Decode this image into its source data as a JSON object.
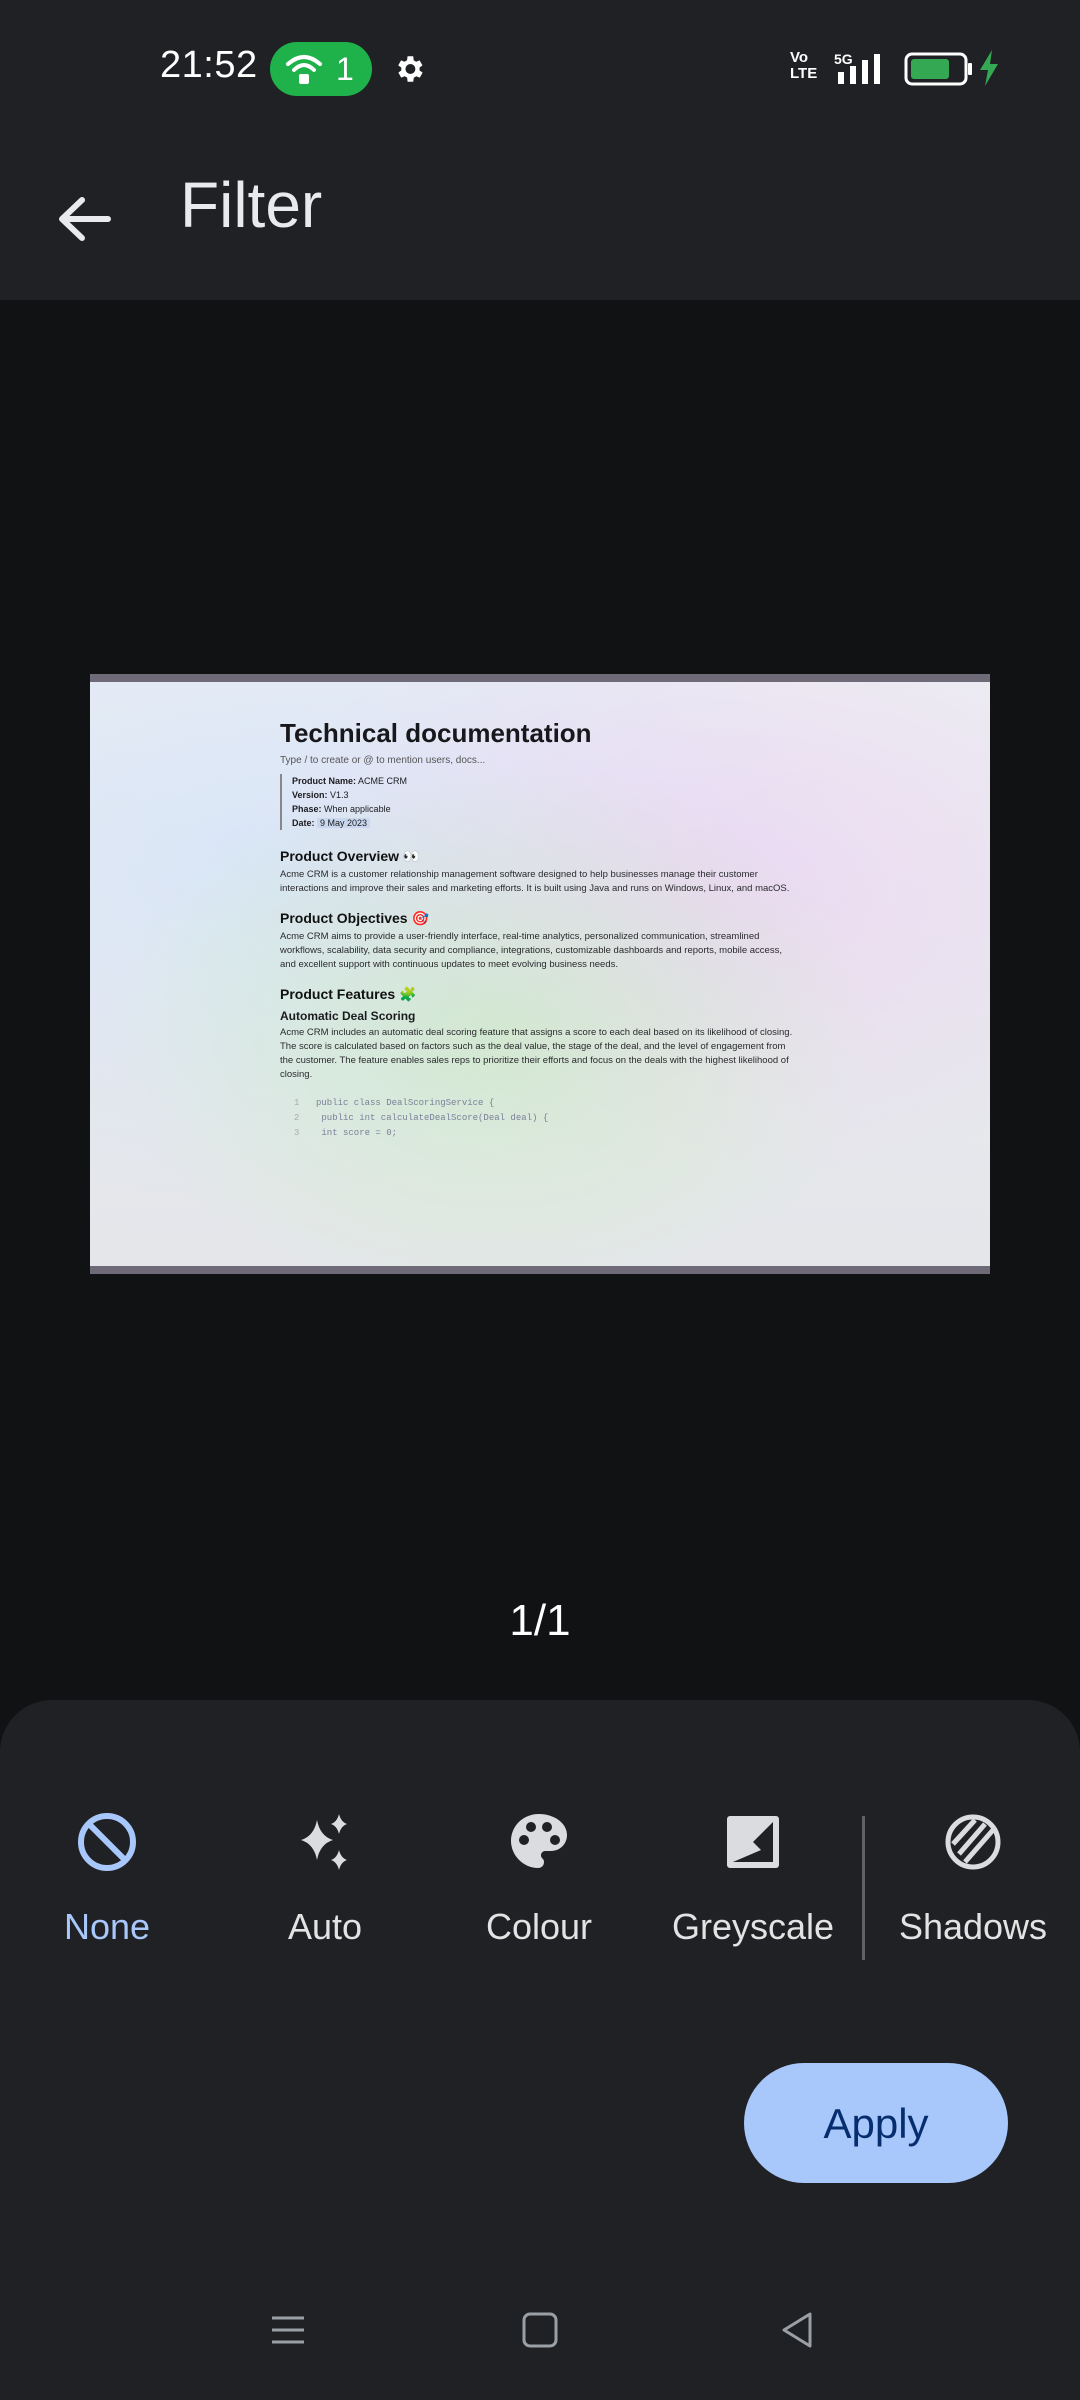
{
  "status_bar": {
    "time": "21:52",
    "hotspot_count": "1",
    "network": "5G",
    "volte_label": "Vo\nLTE"
  },
  "appbar": {
    "title": "Filter"
  },
  "document_preview": {
    "title": "Technical documentation",
    "hint": "Type / to create or @ to mention users, docs...",
    "meta": {
      "product_name_label": "Product Name:",
      "product_name": "ACME CRM",
      "version_label": "Version:",
      "version": "V1.3",
      "phase_label": "Phase:",
      "phase": "When applicable",
      "date_label": "Date:",
      "date": "9 May 2023"
    },
    "sections": [
      {
        "heading": "Product Overview 👀",
        "body": "Acme CRM is a customer relationship management software designed to help businesses manage their customer interactions and improve their sales and marketing efforts. It is built using Java and runs on Windows, Linux, and macOS."
      },
      {
        "heading": "Product Objectives 🎯",
        "body": "Acme CRM aims to provide a user-friendly interface, real-time analytics, personalized communication, streamlined workflows, scalability, data security and compliance, integrations, customizable dashboards and reports, mobile access, and excellent support with continuous updates to meet evolving business needs."
      },
      {
        "heading": "Product Features 🧩",
        "subheading": "Automatic Deal Scoring",
        "body": "Acme CRM includes an automatic deal scoring feature that assigns a score to each deal based on its likelihood of closing. The score is calculated based on factors such as the deal value, the stage of the deal, and the level of engagement from the customer. The feature enables sales reps to prioritize their efforts and focus on the deals with the highest likelihood of closing."
      }
    ],
    "code_lines": [
      "public class DealScoringService {",
      "  public int calculateDealScore(Deal deal) {",
      "    int score = 0;"
    ]
  },
  "pager": "1/1",
  "filters": [
    {
      "label": "None",
      "icon": "block-icon",
      "active": true
    },
    {
      "label": "Auto",
      "icon": "sparkle-icon",
      "active": false
    },
    {
      "label": "Colour",
      "icon": "palette-icon",
      "active": false
    },
    {
      "label": "Greyscale",
      "icon": "greyscale-icon",
      "active": false
    },
    {
      "label": "Shadows",
      "icon": "shadows-icon",
      "active": false
    }
  ],
  "apply_label": "Apply",
  "colors": {
    "accent": "#a8c7fa",
    "surface": "#202124",
    "background": "#111213",
    "hotspot": "#1fb24a"
  }
}
